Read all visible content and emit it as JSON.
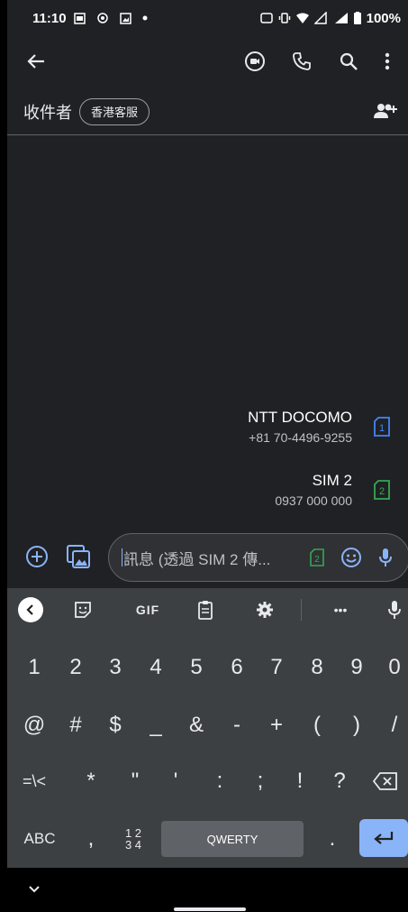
{
  "status_bar": {
    "time": "11:10",
    "battery": "100%"
  },
  "app_bar": {
    "back_icon": "arrow-left-icon",
    "actions": [
      "video-call-icon",
      "phone-icon",
      "search-icon",
      "more-vert-icon"
    ]
  },
  "recipients": {
    "label": "收件者",
    "chip": "香港客服",
    "add_icon": "add-people-icon"
  },
  "sims": [
    {
      "name": "NTT DOCOMO",
      "number": "+81 70-4496-9255",
      "slot": "1",
      "color": "#4285f4"
    },
    {
      "name": "SIM 2",
      "number": "0937 000 000",
      "slot": "2",
      "color": "#34a853"
    }
  ],
  "compose": {
    "placeholder": "訊息 (透過 SIM 2 傳...",
    "sim_slot": "2"
  },
  "keyboard": {
    "toolbar_gif": "GIF",
    "toolbar_more": "•••",
    "row1": [
      "1",
      "2",
      "3",
      "4",
      "5",
      "6",
      "7",
      "8",
      "9",
      "0"
    ],
    "row2": [
      "@",
      "#",
      "$",
      "_",
      "&",
      "-",
      "+",
      "(",
      ")",
      "/"
    ],
    "row3": [
      "=\\<",
      "*",
      "\"",
      "'",
      ":",
      ";",
      "!",
      "?"
    ],
    "row4": {
      "abc": "ABC",
      "comma": ",",
      "fraction_top": "1 2",
      "fraction_bottom": "3 4",
      "space": "QWERTY",
      "period": "."
    }
  },
  "colors": {
    "background": "#202124",
    "keyboard": "#3c4043",
    "accent": "#8ab4f8"
  }
}
